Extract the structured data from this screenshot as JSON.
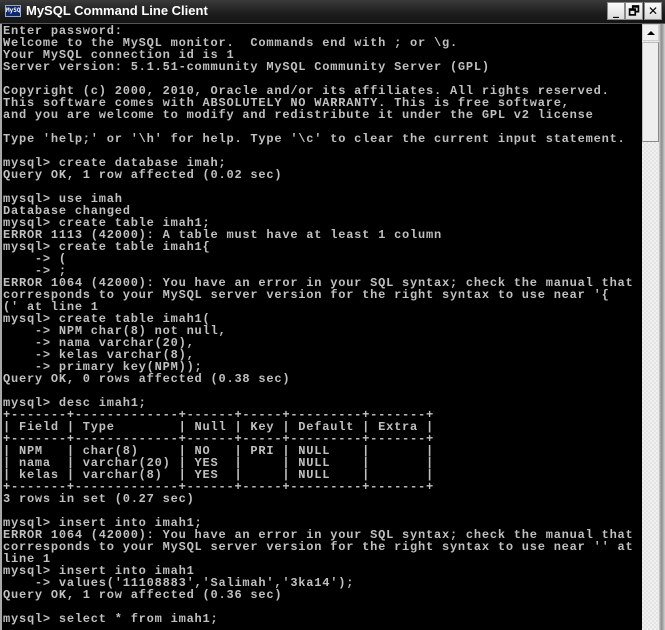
{
  "window": {
    "title": "MySQL Command Line Client",
    "icon": "console-app-icon",
    "icon_glyph": "MySQL",
    "controls": {
      "minimize": "_",
      "maximize": "🗗",
      "close": "✕"
    }
  },
  "scrollbar": {
    "up_arrow": "scroll-up-arrow-icon",
    "position": "top"
  },
  "console": {
    "lines": [
      "Enter password:",
      "Welcome to the MySQL monitor.  Commands end with ; or \\g.",
      "Your MySQL connection id is 1",
      "Server version: 5.1.51-community MySQL Community Server (GPL)",
      "",
      "Copyright (c) 2000, 2010, Oracle and/or its affiliates. All rights reserved.",
      "This software comes with ABSOLUTELY NO WARRANTY. This is free software,",
      "and you are welcome to modify and redistribute it under the GPL v2 license",
      "",
      "Type 'help;' or '\\h' for help. Type '\\c' to clear the current input statement.",
      "",
      "mysql> create database imah;",
      "Query OK, 1 row affected (0.02 sec)",
      "",
      "mysql> use imah",
      "Database changed",
      "mysql> create table imah1;",
      "ERROR 1113 (42000): A table must have at least 1 column",
      "mysql> create table imah1{",
      "    -> (",
      "    -> ;",
      "ERROR 1064 (42000): You have an error in your SQL syntax; check the manual that",
      "corresponds to your MySQL server version for the right syntax to use near '{",
      "(' at line 1",
      "mysql> create table imah1(",
      "    -> NPM char(8) not null,",
      "    -> nama varchar(20),",
      "    -> kelas varchar(8),",
      "    -> primary key(NPM));",
      "Query OK, 0 rows affected (0.38 sec)",
      "",
      "mysql> desc imah1;",
      "+-------+-------------+------+-----+---------+-------+",
      "| Field | Type        | Null | Key | Default | Extra |",
      "+-------+-------------+------+-----+---------+-------+",
      "| NPM   | char(8)     | NO   | PRI | NULL    |       |",
      "| nama  | varchar(20) | YES  |     | NULL    |       |",
      "| kelas | varchar(8)  | YES  |     | NULL    |       |",
      "+-------+-------------+------+-----+---------+-------+",
      "3 rows in set (0.27 sec)",
      "",
      "mysql> insert into imah1;",
      "ERROR 1064 (42000): You have an error in your SQL syntax; check the manual that",
      "corresponds to your MySQL server version for the right syntax to use near '' at",
      "line 1",
      "mysql> insert into imah1",
      "    -> values('11108883','Salimah','3ka14');",
      "Query OK, 1 row affected (0.36 sec)",
      "",
      "mysql> select * from imah1;"
    ]
  },
  "desc_table": {
    "columns": [
      "Field",
      "Type",
      "Null",
      "Key",
      "Default",
      "Extra"
    ],
    "rows": [
      [
        "NPM",
        "char(8)",
        "NO",
        "PRI",
        "NULL",
        ""
      ],
      [
        "nama",
        "varchar(20)",
        "YES",
        "",
        "NULL",
        ""
      ],
      [
        "kelas",
        "varchar(8)",
        "YES",
        "",
        "NULL",
        ""
      ]
    ],
    "summary": "3 rows in set (0.27 sec)"
  },
  "colors": {
    "console_bg": "#000000",
    "console_text": "#c0c0c0",
    "title_text": "#ffffff"
  }
}
